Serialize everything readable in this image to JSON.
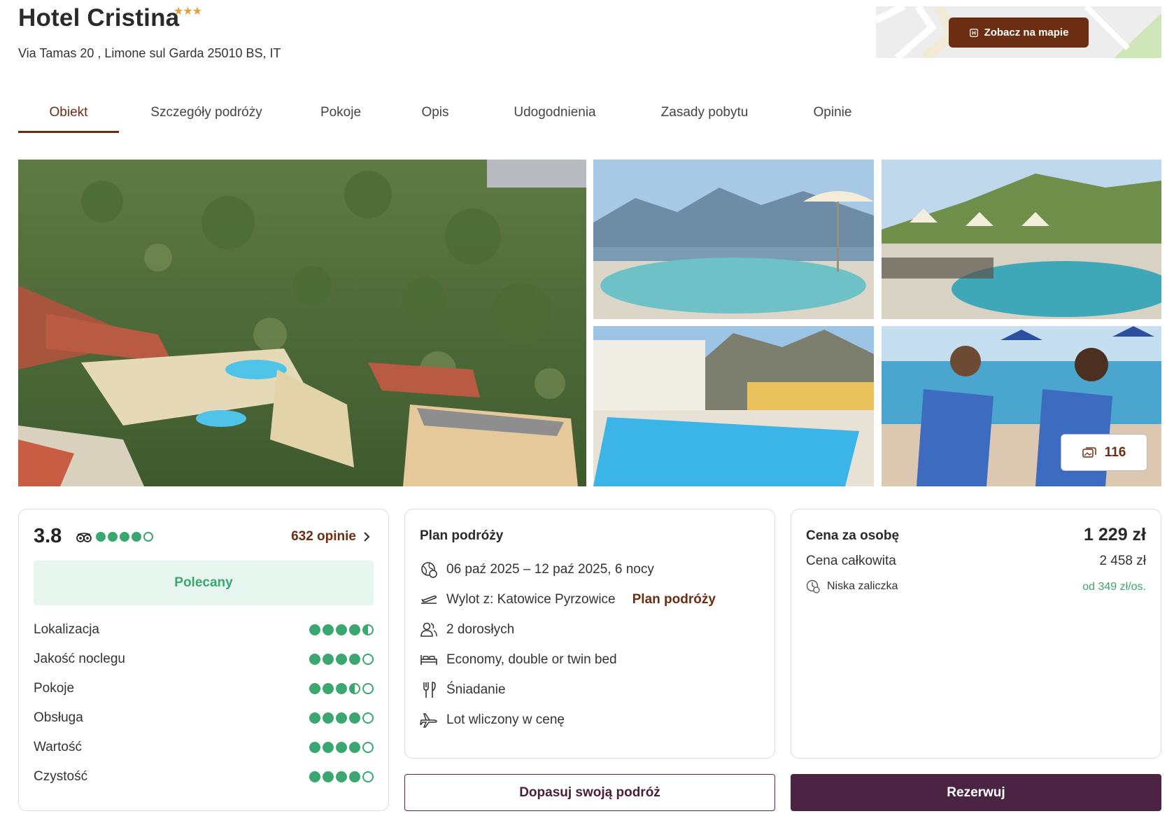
{
  "header": {
    "title": "Hotel Cristina",
    "stars": "★★★",
    "address": "Via Tamas 20 , Limone sul Garda 25010 BS, IT",
    "map_button": "Zobacz na mapie"
  },
  "tabs": [
    {
      "label": "Obiekt",
      "active": true
    },
    {
      "label": "Szczegóły podróży"
    },
    {
      "label": "Pokoje"
    },
    {
      "label": "Opis"
    },
    {
      "label": "Udogodnienia"
    },
    {
      "label": "Zasady pobytu"
    },
    {
      "label": "Opinie"
    }
  ],
  "gallery": {
    "photo_count": "116",
    "photos": [
      "aerial-hotel-view",
      "pool-lake-view",
      "pool-sunloungers",
      "pool-mountains",
      "couple-sunbeds"
    ]
  },
  "rating": {
    "score": "3.8",
    "score_dots": 4,
    "reviews_link": "632 opinie",
    "badge": "Polecany",
    "categories": [
      {
        "label": "Lokalizacja",
        "value": 4.5
      },
      {
        "label": "Jakość noclegu",
        "value": 4
      },
      {
        "label": "Pokoje",
        "value": 3.5
      },
      {
        "label": "Obsługa",
        "value": 4
      },
      {
        "label": "Wartość",
        "value": 4
      },
      {
        "label": "Czystość",
        "value": 4
      }
    ]
  },
  "plan": {
    "title": "Plan podróży",
    "dates": "06 paź 2025 – 12 paź 2025, 6 nocy",
    "departure": "Wylot z: Katowice Pyrzowice",
    "departure_link": "Plan podróży",
    "guests": "2 dorosłych",
    "room": "Economy, double or twin bed",
    "board": "Śniadanie",
    "flight": "Lot wliczony w cenę"
  },
  "price": {
    "per_person_label": "Cena za osobę",
    "per_person_value": "1 229 zł",
    "total_label": "Cena całkowita",
    "total_value": "2 458 zł",
    "deposit_label": "Niska zaliczka",
    "deposit_value": "od 349 zł/os."
  },
  "actions": {
    "customize": "Dopasuj swoją podróż",
    "book": "Rezerwuj"
  },
  "colors": {
    "accent": "#6b2e12",
    "primary_button": "#4a2442",
    "green": "#3aa770",
    "star": "#e0a23a"
  }
}
